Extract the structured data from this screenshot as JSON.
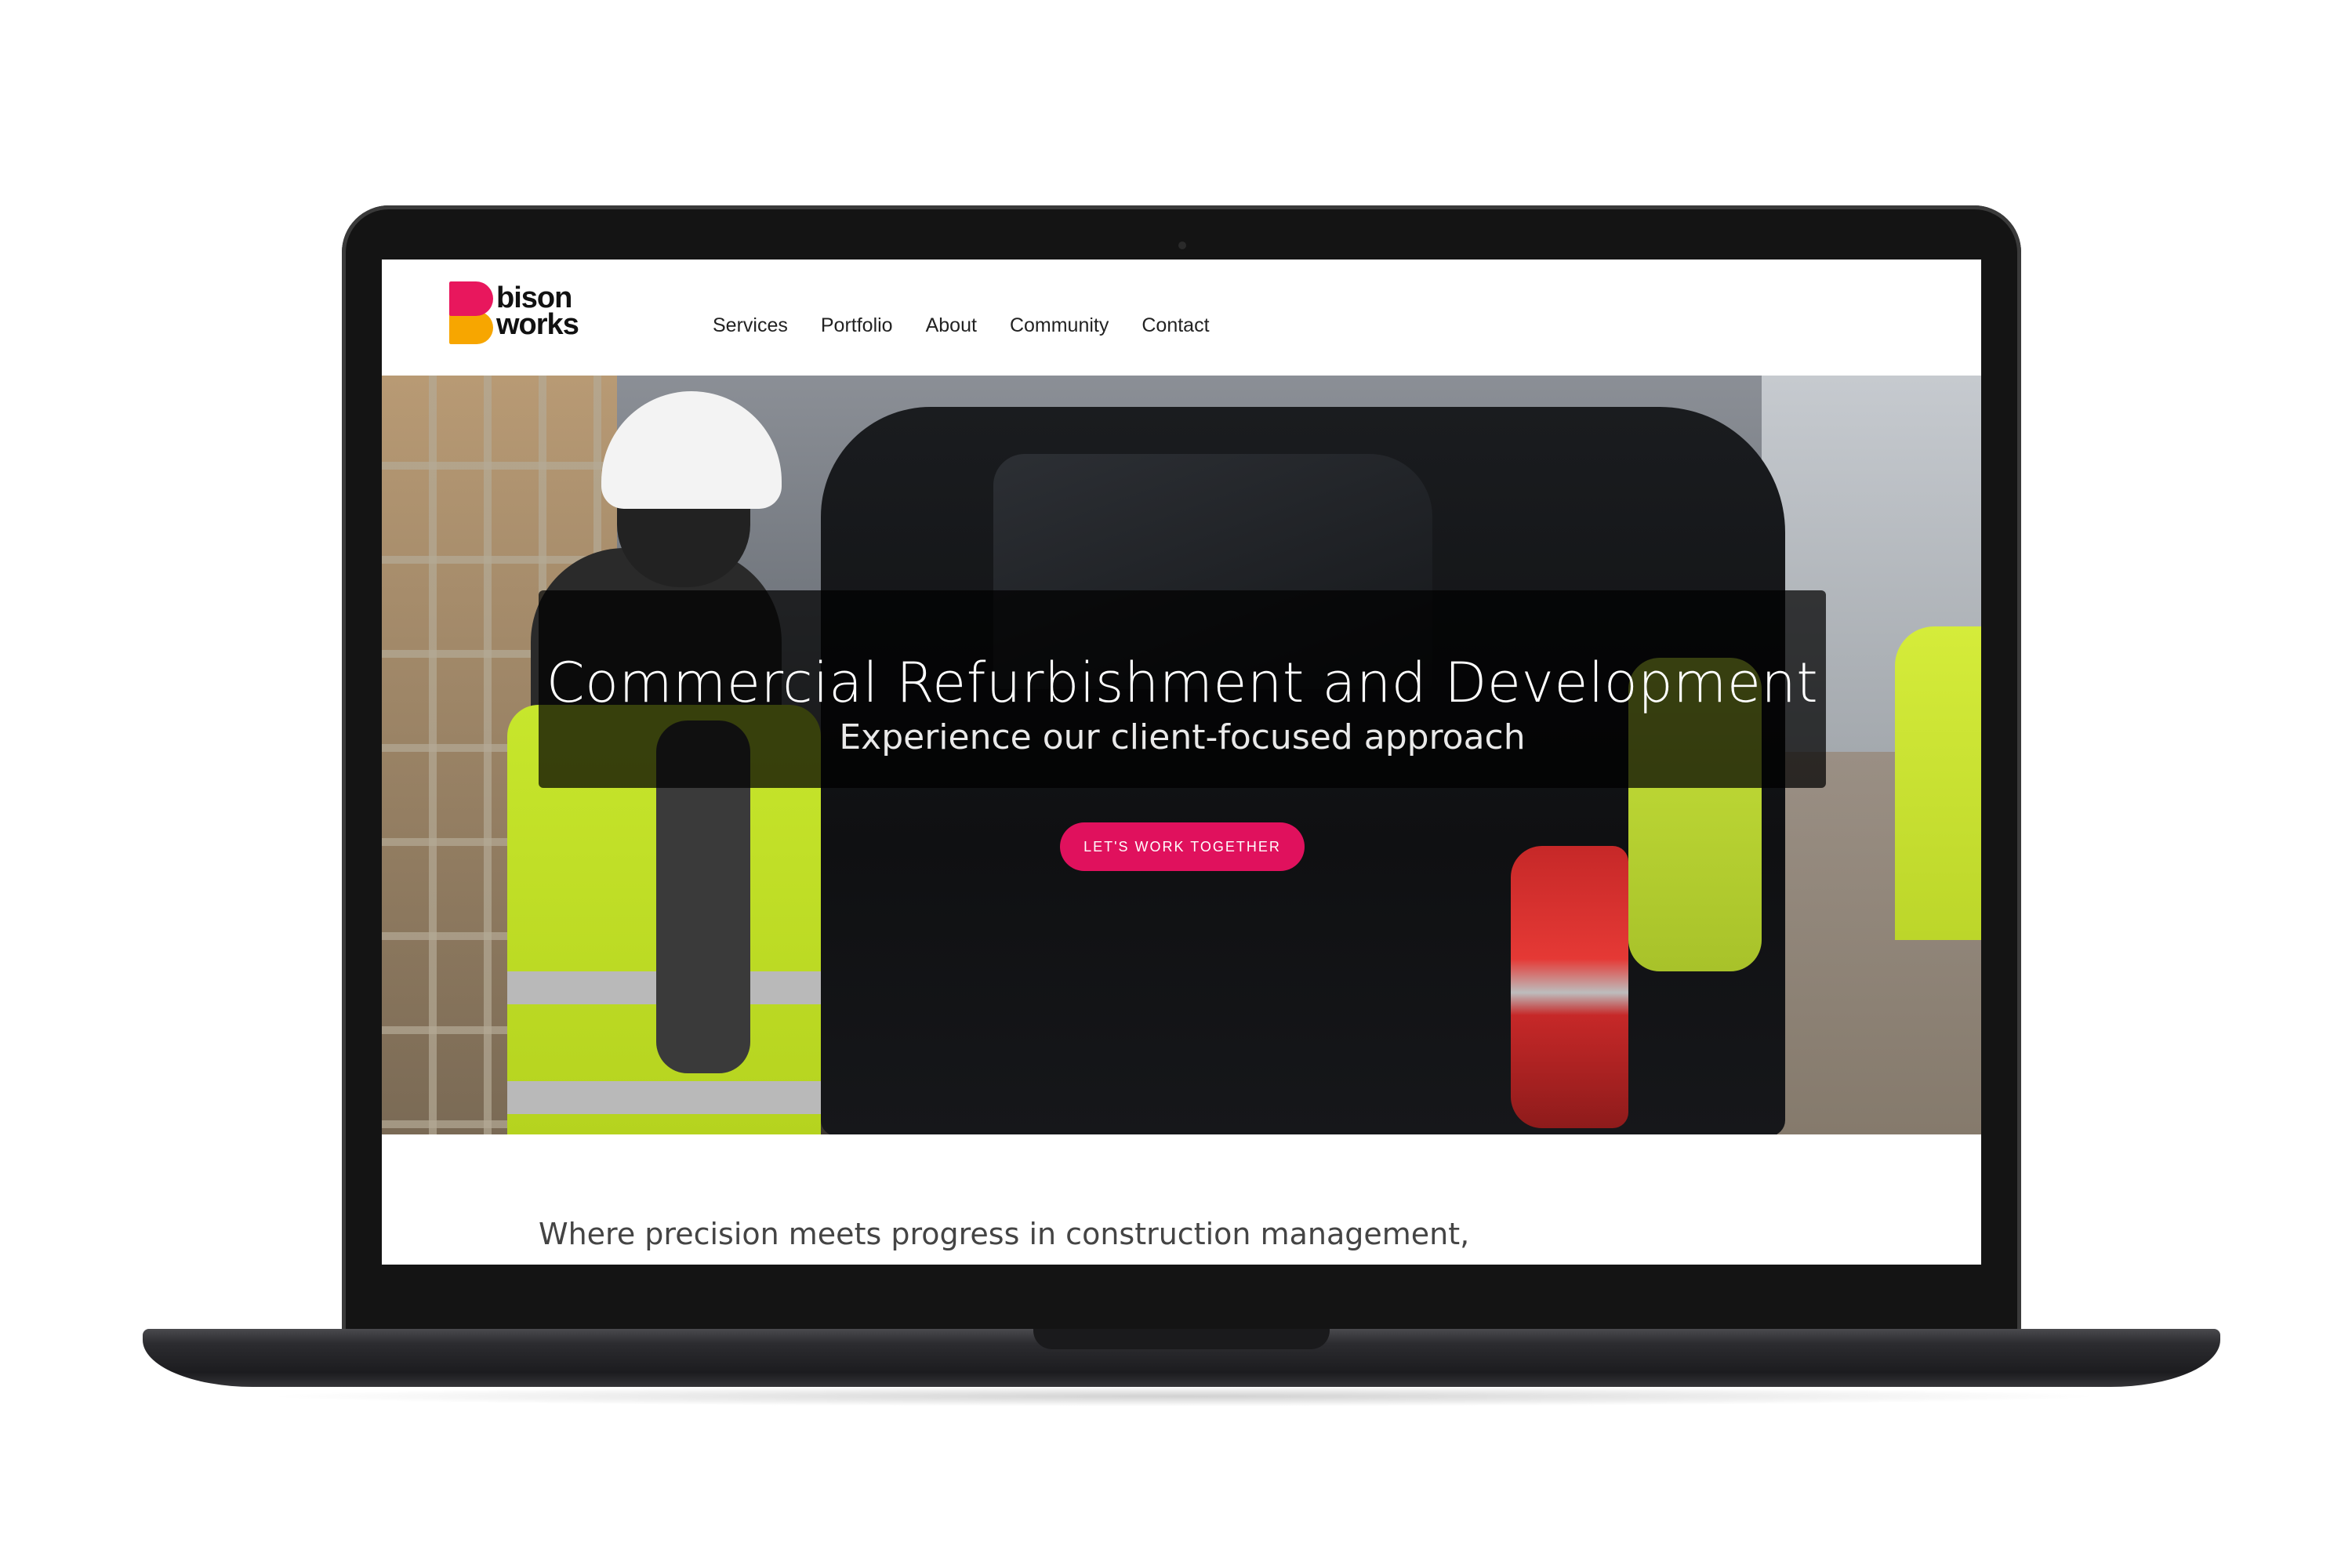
{
  "site": {
    "logo": {
      "line1": "bison",
      "line2": "works"
    },
    "nav": [
      {
        "label": "Services"
      },
      {
        "label": "Portfolio"
      },
      {
        "label": "About"
      },
      {
        "label": "Community"
      },
      {
        "label": "Contact"
      }
    ]
  },
  "hero": {
    "title": "Commercial Refurbishment and Development",
    "subtitle": "Experience our client-focused approach",
    "cta_label": "Let's work together"
  },
  "intro": {
    "text": "Where precision meets progress in construction management, whether you're embarking on a commercial or large residential project, our"
  },
  "colors": {
    "accent": "#e0115d",
    "logo_pink": "#e8175d",
    "logo_orange": "#f7a600",
    "frame": "#141414"
  }
}
